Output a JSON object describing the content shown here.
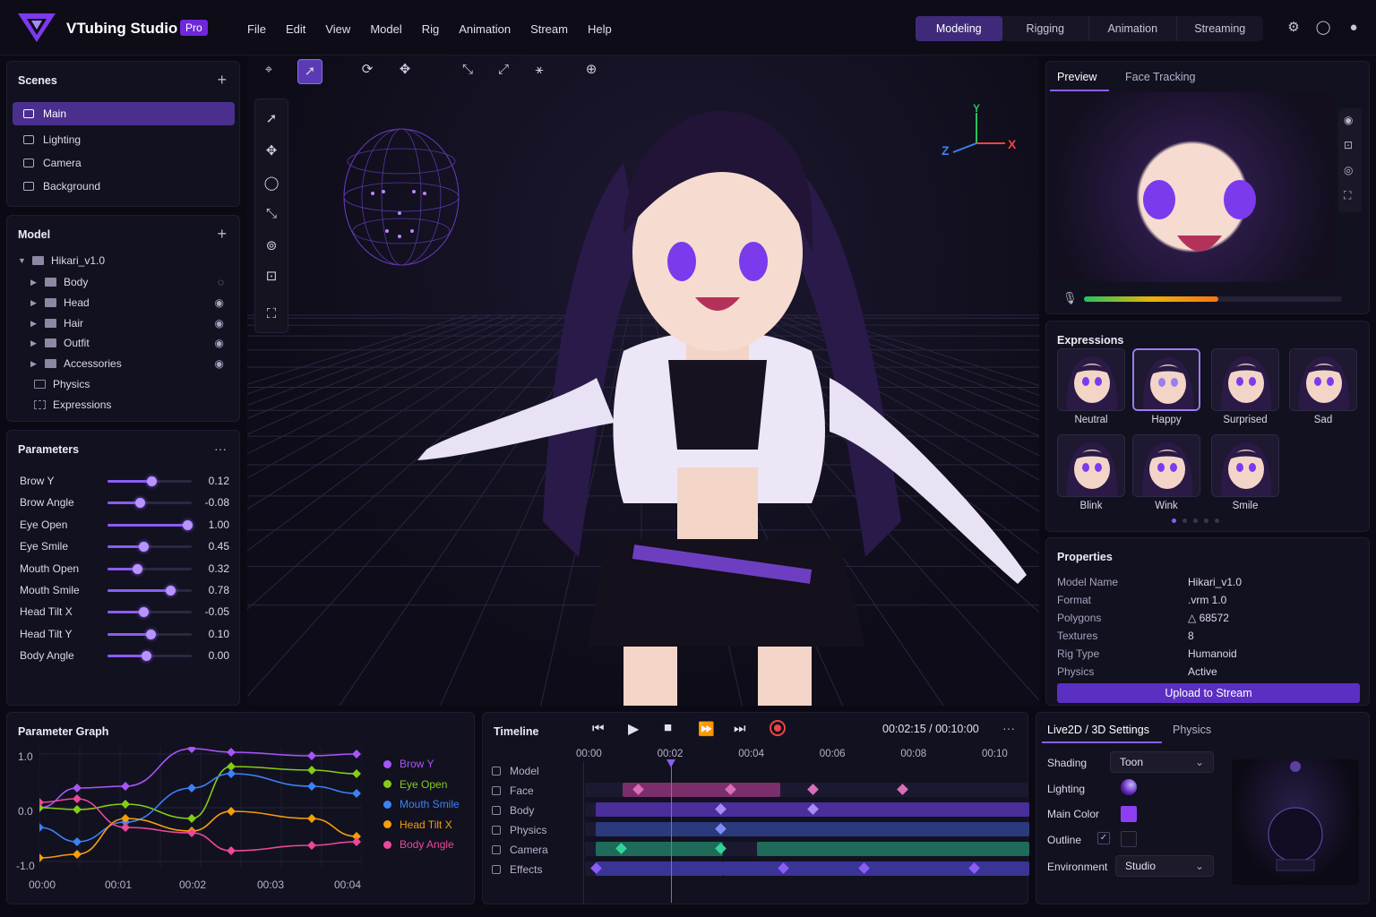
{
  "app": {
    "title": "VTubing Studio",
    "badge": "Pro"
  },
  "menu": [
    "File",
    "Edit",
    "View",
    "Model",
    "Rig",
    "Animation",
    "Stream",
    "Help"
  ],
  "mode_tabs": [
    "Modeling",
    "Rigging",
    "Animation",
    "Streaming"
  ],
  "active_mode": "Modeling",
  "scenes": {
    "title": "Scenes",
    "items": [
      "Main",
      "Lighting",
      "Camera",
      "Background"
    ],
    "active": "Main"
  },
  "model": {
    "title": "Model",
    "root": "Hikari_v1.0",
    "folders": [
      "Body",
      "Head",
      "Hair",
      "Outfit",
      "Accessories"
    ],
    "extras": [
      "Physics",
      "Expressions"
    ]
  },
  "parameters": {
    "title": "Parameters",
    "more": "···",
    "items": [
      {
        "name": "Brow Y",
        "value": "0.12",
        "level": 0.52
      },
      {
        "name": "Brow Angle",
        "value": "-0.08",
        "level": 0.38
      },
      {
        "name": "Eye Open",
        "value": "1.00",
        "level": 0.95
      },
      {
        "name": "Eye Smile",
        "value": "0.45",
        "level": 0.43
      },
      {
        "name": "Mouth Open",
        "value": "0.32",
        "level": 0.35
      },
      {
        "name": "Mouth Smile",
        "value": "0.78",
        "level": 0.74
      },
      {
        "name": "Head Tilt X",
        "value": "-0.05",
        "level": 0.43
      },
      {
        "name": "Head Tilt Y",
        "value": "0.10",
        "level": 0.51
      },
      {
        "name": "Body Angle",
        "value": "0.00",
        "level": 0.46
      }
    ]
  },
  "viewport": {
    "axis_y": "Y",
    "axis_x": "X",
    "axis_z": "Z"
  },
  "preview": {
    "tabs": [
      "Preview",
      "Face Tracking"
    ],
    "active": "Preview"
  },
  "expressions": {
    "title": "Expressions",
    "items": [
      "Neutral",
      "Happy",
      "Surprised",
      "Sad",
      "Blink",
      "Wink",
      "Smile"
    ],
    "active": "Happy",
    "pages": 5,
    "page": 1
  },
  "properties": {
    "title": "Properties",
    "rows": [
      {
        "k": "Model Name",
        "v": "Hikari_v1.0"
      },
      {
        "k": "Format",
        "v": ".vrm 1.0"
      },
      {
        "k": "Polygons",
        "v": "△ 68572"
      },
      {
        "k": "Textures",
        "v": "8"
      },
      {
        "k": "Rig Type",
        "v": "Humanoid"
      },
      {
        "k": "Physics",
        "v": "Active"
      }
    ],
    "button": "Upload to Stream"
  },
  "graph": {
    "title": "Parameter Graph",
    "series": [
      {
        "name": "Brow Y",
        "color": "#a855f7"
      },
      {
        "name": "Eye Open",
        "color": "#84cc16"
      },
      {
        "name": "Mouth Smile",
        "color": "#3b82f6"
      },
      {
        "name": "Head Tilt X",
        "color": "#f59e0b"
      },
      {
        "name": "Body Angle",
        "color": "#ec4899"
      }
    ],
    "y_ticks": [
      "1.0",
      "0.0",
      "-1.0"
    ],
    "x_ticks": [
      "00:00",
      "00:01",
      "00:02",
      "00:03",
      "00:04"
    ]
  },
  "timeline": {
    "title": "Timeline",
    "time": "00:02:15 / 00:10:00",
    "more": "···",
    "ruler": [
      "00:00",
      "00:02",
      "00:04",
      "00:06",
      "00:08",
      "00:10"
    ],
    "tracks": [
      "Model",
      "Face",
      "Body",
      "Physics",
      "Camera",
      "Effects"
    ]
  },
  "settings": {
    "tabs": [
      "Live2D / 3D Settings",
      "Physics"
    ],
    "active": "Live2D / 3D Settings",
    "shading_label": "Shading",
    "shading_value": "Toon",
    "lighting_label": "Lighting",
    "main_color_label": "Main Color",
    "main_color": "#8b3ff0",
    "outline_label": "Outline",
    "outline_checked": true,
    "environment_label": "Environment",
    "environment_value": "Studio"
  },
  "colors": {
    "accent": "#7c3aed",
    "panel": "#121120",
    "bg": "#0b0a14"
  }
}
